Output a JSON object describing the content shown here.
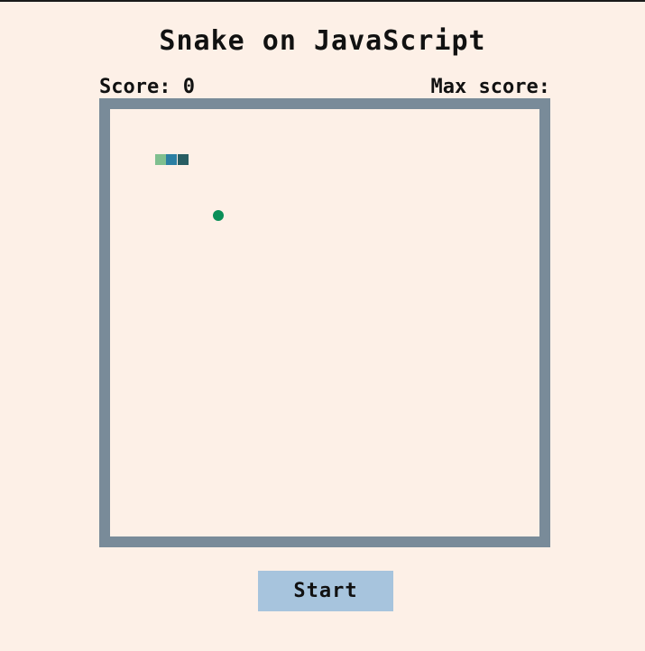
{
  "title": "Snake on JavaScript",
  "score": {
    "label": "Score:",
    "value": "0",
    "max_label": "Max score:",
    "max_value": ""
  },
  "game": {
    "snake_segments": [
      {
        "role": "tail",
        "color": "#7fbf8f"
      },
      {
        "role": "body",
        "color": "#2b7fa3"
      },
      {
        "role": "head",
        "color": "#285e63"
      }
    ],
    "food_color": "#0a8f58"
  },
  "controls": {
    "start_label": "Start"
  },
  "colors": {
    "background": "#fdf0e7",
    "board_border": "#798b99",
    "button": "#a7c4dd"
  }
}
